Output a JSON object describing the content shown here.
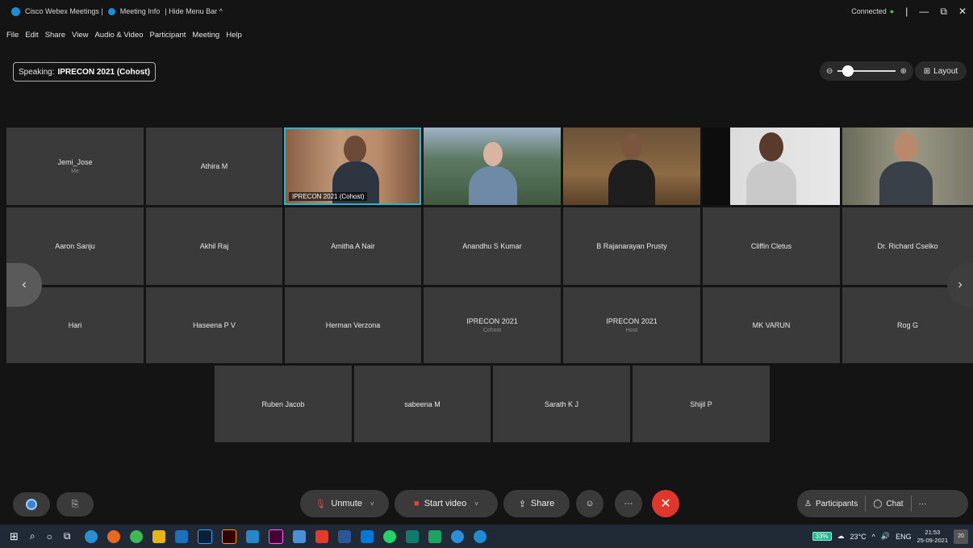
{
  "titlebar": {
    "app_title": "Cisco Webex Meetings |",
    "meeting_info": "Meeting Info",
    "hide_menu": "| Hide Menu Bar ^",
    "status": "Connected",
    "minimize": "—",
    "restore": "⧉",
    "close": "✕",
    "pipe": "|"
  },
  "menu": [
    "File",
    "Edit",
    "Share",
    "View",
    "Audio & Video",
    "Participant",
    "Meeting",
    "Help"
  ],
  "speaking": {
    "prefix": "Speaking:",
    "name": "IPRECON 2021 (Cohost)"
  },
  "zoom": {
    "minus": "⊖",
    "plus": "⊕",
    "level": 0.1
  },
  "layout": {
    "label": "Layout",
    "icon": "⊞"
  },
  "video_tiles": [
    {
      "label": "IPRECON 2021  (Cohost)"
    }
  ],
  "rows": {
    "row1": [
      {
        "name": "Jemi_Jose",
        "role": "Me"
      },
      {
        "name": "Athira M",
        "role": ""
      }
    ],
    "row2": [
      {
        "name": "Aaron Sanju",
        "role": ""
      },
      {
        "name": "Akhil Raj",
        "role": ""
      },
      {
        "name": "Amitha A Nair",
        "role": ""
      },
      {
        "name": "Anandhu S Kumar",
        "role": ""
      },
      {
        "name": "B Rajanarayan Prusty",
        "role": ""
      },
      {
        "name": "Cliffin Cletus",
        "role": ""
      },
      {
        "name": "Dr. Richard Cselko",
        "role": ""
      }
    ],
    "row3": [
      {
        "name": "Hari",
        "role": ""
      },
      {
        "name": "Haseena P V",
        "role": ""
      },
      {
        "name": "Herman Verzona",
        "role": ""
      },
      {
        "name": "IPRECON 2021",
        "role": "Cohost"
      },
      {
        "name": "IPRECON 2021",
        "role": "Host"
      },
      {
        "name": "MK VARUN",
        "role": ""
      },
      {
        "name": "Rog G",
        "role": ""
      }
    ],
    "row4": [
      {
        "name": "Ruben Jacob",
        "role": ""
      },
      {
        "name": "sabeena M",
        "role": ""
      },
      {
        "name": "Sarath K J",
        "role": ""
      },
      {
        "name": "Shijil P",
        "role": ""
      }
    ]
  },
  "nav": {
    "prev": "‹",
    "next": "›"
  },
  "controls": {
    "unmute": "Unmute",
    "start_video": "Start video",
    "share": "Share",
    "more": "···",
    "end": "✕",
    "participants": "Participants",
    "chat": "Chat",
    "overflow": "···",
    "caret": "˅"
  },
  "taskbar": {
    "battery": "33%",
    "temperature": "23°C",
    "language": "ENG",
    "time": "21:53",
    "date": "25-09-2021",
    "notifications": "20"
  },
  "colors": {
    "accent": "#25b6d4",
    "end_call": "#e0362b",
    "mute_red": "#e0453a",
    "connected": "#3fc25a",
    "tile_bg": "#3a3a3a"
  }
}
